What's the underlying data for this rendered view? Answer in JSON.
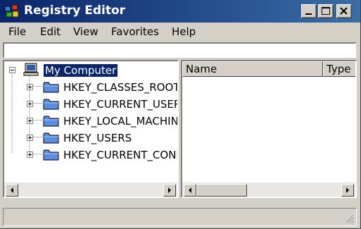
{
  "window": {
    "title": "Registry Editor",
    "icons": {
      "app": "registry-icon",
      "minimize": "minimize-icon",
      "maximize": "maximize-icon",
      "close": "close-icon"
    }
  },
  "menu": {
    "items": [
      "File",
      "Edit",
      "View",
      "Favorites",
      "Help"
    ]
  },
  "address": {
    "value": ""
  },
  "tree": {
    "root": {
      "label": "My Computer",
      "icon": "computer-icon",
      "expanded": true,
      "selected": true
    },
    "children": [
      {
        "label": "HKEY_CLASSES_ROOT",
        "icon": "folder-icon"
      },
      {
        "label": "HKEY_CURRENT_USER",
        "icon": "folder-icon"
      },
      {
        "label": "HKEY_LOCAL_MACHINE",
        "icon": "folder-icon"
      },
      {
        "label": "HKEY_USERS",
        "icon": "folder-icon"
      },
      {
        "label": "HKEY_CURRENT_CONFIG",
        "icon": "folder-icon"
      }
    ]
  },
  "list": {
    "columns": [
      "Name",
      "Type"
    ]
  },
  "status": {
    "text": ""
  },
  "colors": {
    "title_start": "#0a246a",
    "title_end": "#3a6ea5",
    "face": "#d4d0c8",
    "selection": "#0a246a"
  }
}
